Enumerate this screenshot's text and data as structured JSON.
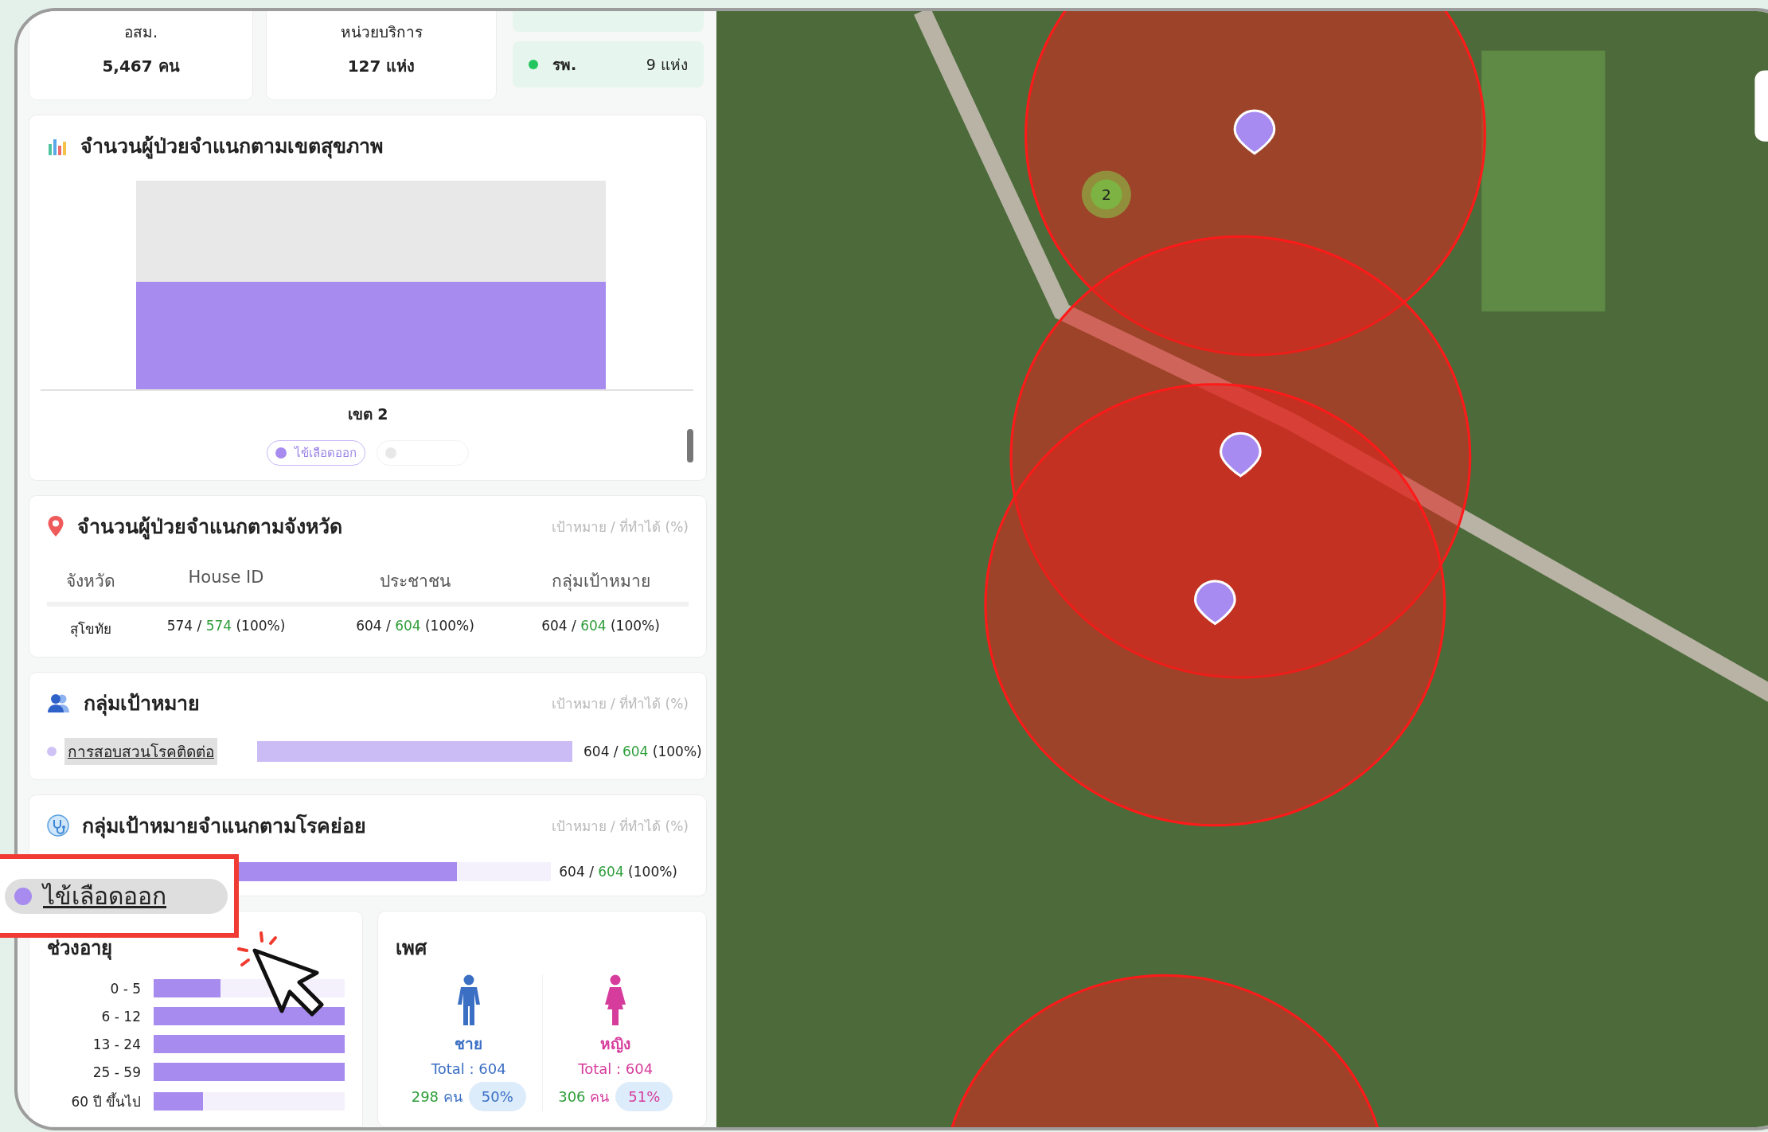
{
  "summary_cards": [
    {
      "label": "อสม.",
      "value": "5,467 คน"
    },
    {
      "label": "หน่วยบริการ",
      "value": "127 แห่ง"
    }
  ],
  "facility_types": [
    {
      "label": "รพ.",
      "count": "9 แห่ง",
      "color": "#22c55e"
    }
  ],
  "region_chart": {
    "title": "จำนวนผู้ป่วยจำแนกตามเขตสุขภาพ",
    "category": "เขต 2",
    "legend": [
      {
        "label": "ไข้เลือดออก",
        "selected": true
      },
      {
        "selected": false
      }
    ]
  },
  "province_table": {
    "title": "จำนวนผู้ป่วยจำแนกตามจังหวัด",
    "hint": "เป้าหมาย / ที่ทำได้ (%)",
    "columns": [
      "จังหวัด",
      "House ID",
      "ประชาชน",
      "กลุ่มเป้าหมาย"
    ],
    "rows": [
      {
        "cells": [
          {
            "text": "สุโขทัย"
          },
          {
            "target": "574 /",
            "done": "574",
            "percent": "(100%)"
          },
          {
            "target": "604 /",
            "done": "604",
            "percent": "(100%)"
          },
          {
            "target": "604 /",
            "done": "604",
            "percent": "(100%)"
          }
        ]
      }
    ]
  },
  "target_groups": {
    "title": "กลุ่มเป้าหมาย",
    "hint": "เป้าหมาย / ที่ทำได้ (%)",
    "items": [
      {
        "label": "การสอบสวนโรคติดต่อ",
        "level": 1,
        "target": "604 /",
        "done": "604",
        "percent": "(100%)"
      }
    ]
  },
  "sub_diseases": {
    "title": "กลุ่มเป้าหมายจำแนกตามโรคย่อย",
    "hint": "เป้าหมาย / ที่ทำได้ (%)",
    "items": [
      {
        "label": "ไข้เลือดออก",
        "level": 0.7,
        "target": "604 /",
        "done": "604",
        "percent": "(100%)"
      }
    ]
  },
  "age_groups": {
    "title": "ช่วงอายุ",
    "bars": [
      {
        "label": "0 - 5",
        "level": 0.35
      },
      {
        "label": "6 - 12",
        "level": 1
      },
      {
        "label": "13 - 24",
        "level": 1
      },
      {
        "label": "25 - 59",
        "level": 1
      },
      {
        "label": "60 ปี ขึ้นไป",
        "level": 0.26
      }
    ]
  },
  "gender": {
    "title": "เพศ",
    "groups": [
      {
        "kind": "male",
        "label": "ชาย",
        "total": "Total : 604",
        "count": "298",
        "unit": "คน",
        "percent": "50%"
      },
      {
        "kind": "female",
        "label": "หญิง",
        "total": "Total : 604",
        "count": "306",
        "unit": "คน",
        "percent": "51%"
      }
    ]
  },
  "map": {
    "cluster_label": "2"
  }
}
